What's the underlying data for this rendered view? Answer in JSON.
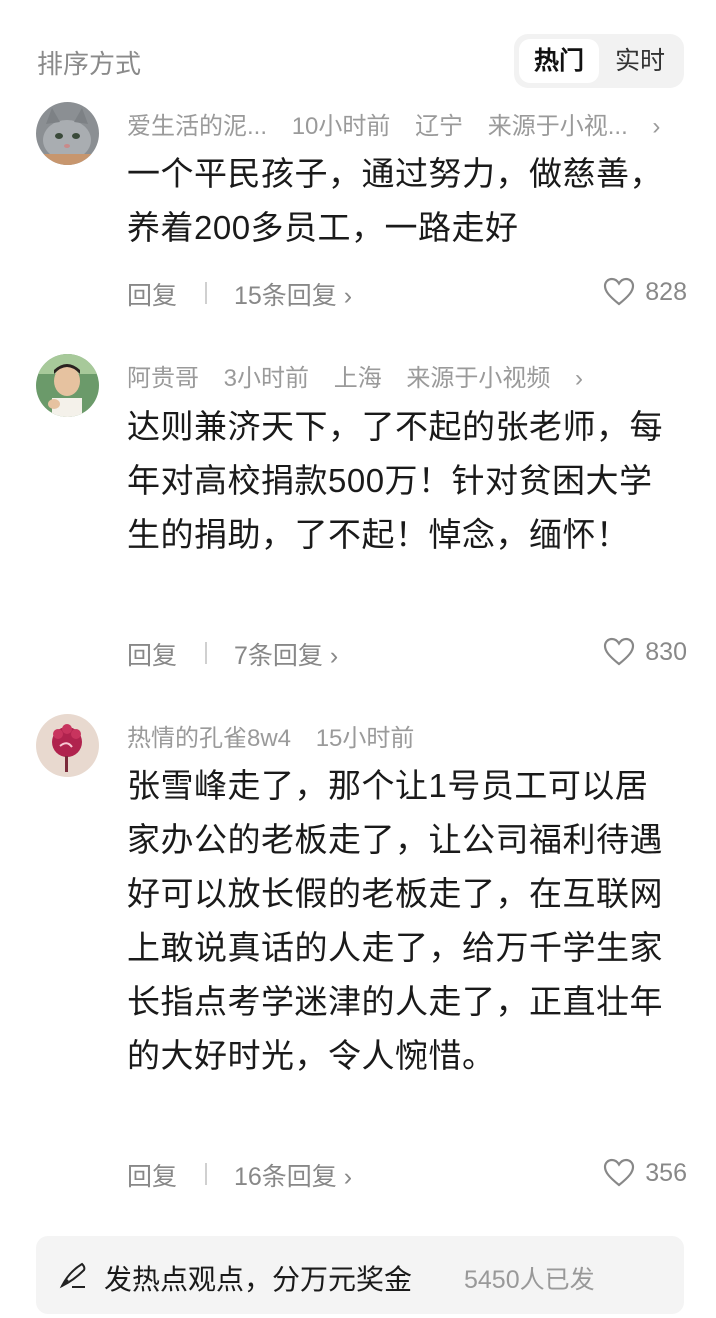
{
  "sort": {
    "label": "排序方式",
    "options": [
      "热门",
      "实时"
    ],
    "selected": "热门"
  },
  "comments": [
    {
      "avatar_icon": "cat-avatar",
      "username": "爱生活的泥...",
      "time": "10小时前",
      "location": "辽宁",
      "source": "来源于小视...",
      "text": "一个平民孩子，通过努力，做慈善，养着200多员工，一路走好",
      "reply_label": "回复",
      "replies": "15条回复",
      "likes": "828"
    },
    {
      "avatar_icon": "man-avatar",
      "username": "阿贵哥",
      "time": "3小时前",
      "location": "上海",
      "source": "来源于小视频",
      "text": "达则兼济天下，了不起的张老师，每年对高校捐款500万！针对贫困大学生的捐助，了不起！悼念，缅怀！",
      "reply_label": "回复",
      "replies": "7条回复",
      "likes": "830"
    },
    {
      "avatar_icon": "flower-avatar",
      "username": "热情的孔雀8w4",
      "time": "15小时前",
      "text": "张雪峰走了，那个让1号员工可以居家办公的老板走了，让公司福利待遇好可以放长假的老板走了，在互联网上敢说真话的人走了，给万千学生家长指点考学迷津的人走了，正直壮年的大好时光，令人惋惜。",
      "reply_label": "回复",
      "replies": "16条回复",
      "likes": "356"
    }
  ],
  "footer": {
    "icon": "pen-icon",
    "text": "发热点观点，分万元奖金",
    "count": "5450人已发"
  },
  "colors": {
    "meta": "#9a9a9a",
    "text": "#1a1a1a",
    "toggle_bg": "#f2f2f2",
    "footer_bg": "#f4f4f4"
  }
}
